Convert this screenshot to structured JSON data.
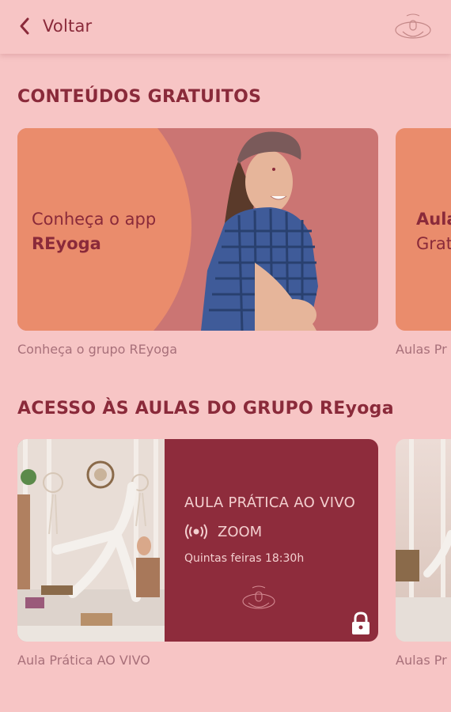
{
  "header": {
    "back_label": "Voltar",
    "back_icon": "chevron-left-icon",
    "logo_icon": "brand-logo"
  },
  "sections": [
    {
      "title": "CONTEÚDOS GRATUITOS",
      "cards": [
        {
          "line1": "Conheça o app",
          "line2": "REyoga",
          "caption": "Conheça o grupo REyoga"
        },
        {
          "line1": "Aula",
          "line2": "Grat",
          "caption": "Aulas Pr"
        }
      ]
    },
    {
      "title": "ACESSO ÀS AULAS DO GRUPO REyoga",
      "cards": [
        {
          "title": "AULA PRÁTICA AO VIVO",
          "platform": "ZOOM",
          "schedule": "Quintas feiras 18:30h",
          "caption": "Aula Prática AO VIVO",
          "lock_icon": "lock-icon"
        },
        {
          "caption": "Aulas Pr"
        }
      ]
    }
  ],
  "colors": {
    "background": "#f7c5c5",
    "primary": "#8a2a3a",
    "accent_orange": "#ea8c6c",
    "card_dark": "#8e2c3c"
  }
}
